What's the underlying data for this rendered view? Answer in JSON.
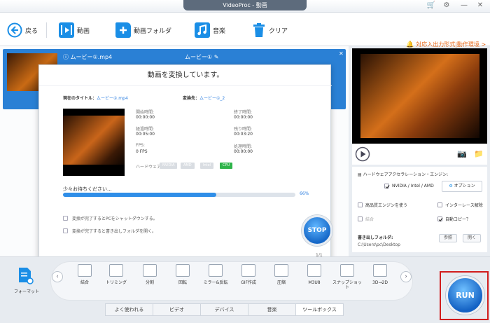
{
  "app": {
    "title": "VideoProc - 動画"
  },
  "toolbar": {
    "back_label": "戻る",
    "video_label": "動画",
    "video_folder_label": "動画フォルダ",
    "music_label": "音楽",
    "clear_label": "クリア",
    "support_link": "対応入出力形式|動作環境 >"
  },
  "video_row": {
    "title": "ムービー①.mp4",
    "output_name": "ムービー①"
  },
  "dialog": {
    "title": "動画を変換しています。",
    "current_title_label": "現在のタイトル：",
    "current_title_value": "ムービー①.mp4",
    "output_name_label": "変換先：",
    "output_name_value": "ムービー①_2",
    "start_time_label": "開始時間:",
    "start_time_value": "00:00:00",
    "end_time_label": "終了時間:",
    "end_time_value": "00:00:00",
    "elapsed_label": "経過時間:",
    "elapsed_value": "00:05:00",
    "remaining_label": "残り時間:",
    "remaining_value": "00:03:20",
    "fps_label": "FPS:",
    "fps_value": "0 FPS",
    "extra_label": "処理時間:",
    "extra_value": "00:00:00",
    "hardware_label": "ハードウェア:",
    "hw_nvidia": "NVIDIA",
    "hw_amd": "AMD",
    "hw_intel": "Intel",
    "hw_cpu": "CPU",
    "progress_label": "少々お待ちください...",
    "progress_pct": "66%",
    "progress_fraction": 0.66,
    "shutdown_option": "変換が完了するとPCをシャットダウンする。",
    "open_folder_option": "変換が完了すると書き出しフォルダを開く。",
    "stop_label": "STOP",
    "page": "1/1"
  },
  "settings": {
    "hw_accel_title": "ハードウェアアクセラレーション・エンジン:",
    "hw_engine": "NVIDIA / Intel / AMD",
    "option_button": "オプション",
    "high_quality": "高品質エンジンを使う",
    "deinterlace": "インターレース解除",
    "merge": "結合",
    "auto_copy": "自動コピー？",
    "output_folder_label": "書き出しフォルダ:",
    "output_folder_path": "C:\\Users\\pc\\Desktop",
    "browse_button": "参照",
    "open_button": "開く"
  },
  "tools": {
    "format_label": "フォーマット",
    "items": [
      "結合",
      "トリミング",
      "分割",
      "回転",
      "ミラー&反転",
      "GIF作成",
      "圧縮",
      "M3U8",
      "スナップショット",
      "3D→2D"
    ]
  },
  "tabs": [
    "よく使われる",
    "ビデオ",
    "デバイス",
    "音楽",
    "ツールボックス"
  ],
  "run_label": "RUN"
}
